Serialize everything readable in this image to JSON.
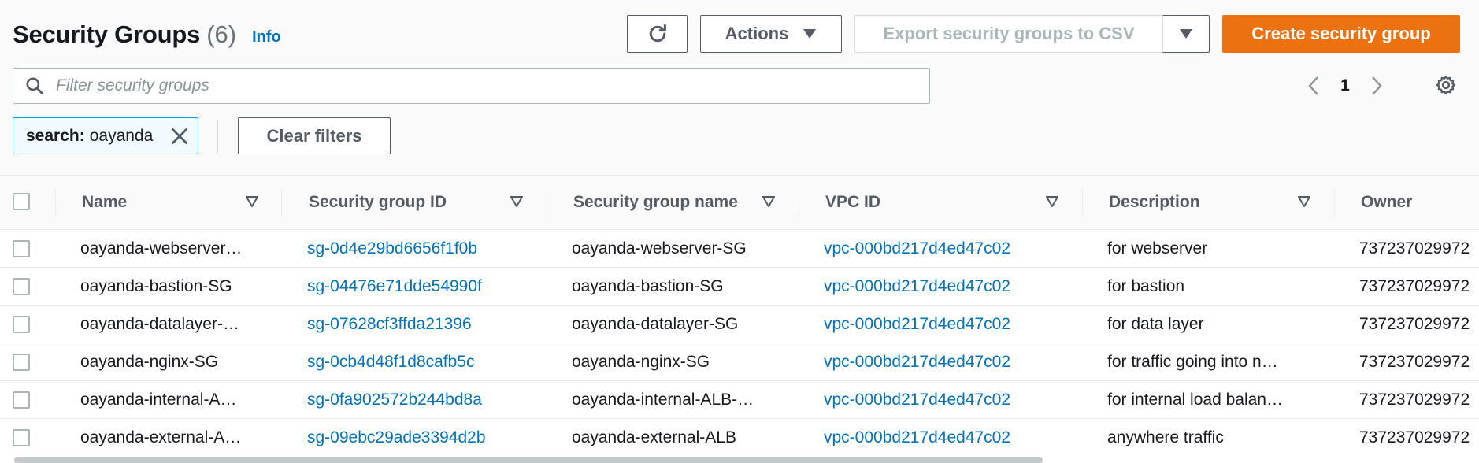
{
  "header": {
    "title": "Security Groups",
    "count": "(6)",
    "info": "Info"
  },
  "toolbar": {
    "actions_label": "Actions",
    "export_label": "Export security groups to CSV",
    "create_label": "Create security group"
  },
  "search": {
    "placeholder": "Filter security groups"
  },
  "pagination": {
    "current_page": "1"
  },
  "filter_token": {
    "label": "search:",
    "value": "oayanda"
  },
  "clear_filters_label": "Clear filters",
  "table": {
    "columns": [
      "Name",
      "Security group ID",
      "Security group name",
      "VPC ID",
      "Description",
      "Owner"
    ],
    "rows": [
      {
        "name": "oayanda-webserver…",
        "sg_id": "sg-0d4e29bd6656f1f0b",
        "sg_name": "oayanda-webserver-SG",
        "vpc_id": "vpc-000bd217d4ed47c02",
        "description": "for webserver",
        "owner": "737237029972"
      },
      {
        "name": "oayanda-bastion-SG",
        "sg_id": "sg-04476e71dde54990f",
        "sg_name": "oayanda-bastion-SG",
        "vpc_id": "vpc-000bd217d4ed47c02",
        "description": "for bastion",
        "owner": "737237029972"
      },
      {
        "name": "oayanda-datalayer-…",
        "sg_id": "sg-07628cf3ffda21396",
        "sg_name": "oayanda-datalayer-SG",
        "vpc_id": "vpc-000bd217d4ed47c02",
        "description": "for data layer",
        "owner": "737237029972"
      },
      {
        "name": "oayanda-nginx-SG",
        "sg_id": "sg-0cb4d48f1d8cafb5c",
        "sg_name": "oayanda-nginx-SG",
        "vpc_id": "vpc-000bd217d4ed47c02",
        "description": "for traffic going into n…",
        "owner": "737237029972"
      },
      {
        "name": "oayanda-internal-A…",
        "sg_id": "sg-0fa902572b244bd8a",
        "sg_name": "oayanda-internal-ALB-…",
        "vpc_id": "vpc-000bd217d4ed47c02",
        "description": "for internal load balan…",
        "owner": "737237029972"
      },
      {
        "name": "oayanda-external-A…",
        "sg_id": "sg-09ebc29ade3394d2b",
        "sg_name": "oayanda-external-ALB",
        "vpc_id": "vpc-000bd217d4ed47c02",
        "description": "anywhere traffic",
        "owner": "737237029972"
      }
    ]
  },
  "colors": {
    "accent_orange": "#ec7211",
    "link_blue": "#0073bb",
    "token_border": "#00a1c9"
  },
  "icons": [
    "refresh-icon",
    "caret-down-icon",
    "search-icon",
    "chevron-left-icon",
    "chevron-right-icon",
    "gear-icon",
    "close-icon",
    "sort-icon"
  ]
}
